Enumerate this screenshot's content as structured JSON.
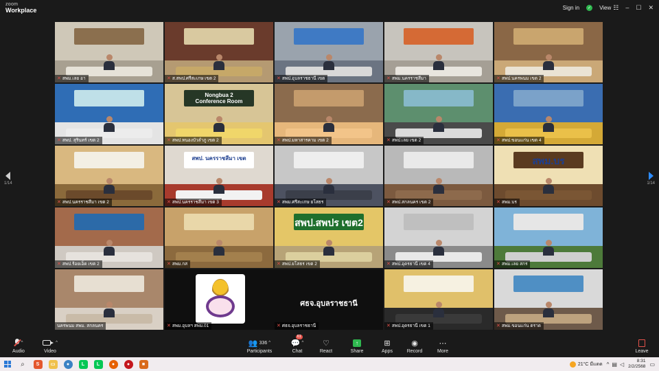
{
  "app": {
    "brand_top": "zoom",
    "brand_bottom": "Workplace",
    "sign_in": "Sign in",
    "view": "View",
    "window_controls": [
      "–",
      "☐",
      "✕"
    ]
  },
  "pager": {
    "left": "1/14",
    "right": "1/14"
  },
  "tiles": [
    {
      "caption": "สพม.เลย อา",
      "muted": true,
      "bg": "#cfc8b8",
      "floor": "#a8a091",
      "banner": "#8b6f4e",
      "table": "#e6e2d8",
      "active": true
    },
    {
      "caption": "ส.สพป.ศรีสะเกษ เขต 2",
      "muted": true,
      "bg": "#6a3b2c",
      "floor": "#b59a72",
      "banner": "#d9c9a0",
      "table": "#c6a868",
      "big": ""
    },
    {
      "caption": "สพป.อุบลราชธานี เขต",
      "muted": true,
      "bg": "#9aa3ad",
      "floor": "#6b7482",
      "banner": "#3f7ac4",
      "table": "#d8d8d8"
    },
    {
      "caption": "สพม.นครราชสีมา",
      "muted": true,
      "bg": "#c7c4bd",
      "floor": "#a59f95",
      "banner": "#d56a35",
      "table": "#e8e5de"
    },
    {
      "caption": "สพป.นครพนม เขต 2",
      "muted": true,
      "bg": "#8a6746",
      "floor": "#caa877",
      "banner": "#c9a56e",
      "table": "#eae3d4"
    },
    {
      "caption": "สพป. สุรินทร์ เขต 2",
      "muted": true,
      "bg": "#2f6db5",
      "floor": "#e4e4e4",
      "banner": "#bfe0e8",
      "table": "#ececec"
    },
    {
      "caption": "สพป.หนองบัวลำภู เขต 2",
      "muted": true,
      "bg": "#d7c596",
      "floor": "#e4c66f",
      "banner": "#263726",
      "table": "#f0d66a",
      "big": "Nongbua 2\nConference Room"
    },
    {
      "caption": "สพป.มหาสารคาม เขต 2",
      "muted": true,
      "bg": "#8b6b4d",
      "floor": "#e6b77b",
      "banner": "#c49b6c",
      "table": "#f2c489"
    },
    {
      "caption": "สพป.เลย เขต 2",
      "muted": true,
      "bg": "#5d8f6e",
      "floor": "#4a4a4a",
      "banner": "#86b8c8",
      "table": "#dadada"
    },
    {
      "caption": "สพป.ขอนแก่น เขต 4",
      "muted": true,
      "bg": "#3a6db1",
      "floor": "#d4a936",
      "banner": "#7ba2c9",
      "table": "#eac049"
    },
    {
      "caption": "สพป.นครราชสีมา เขต 2",
      "muted": true,
      "bg": "#d9b880",
      "floor": "#8b6a3b",
      "banner": "#f3efe4",
      "table": "#6b4a2b"
    },
    {
      "caption": "สพป.นครราชสีมา เขต 3",
      "muted": true,
      "bg": "#dfd9d0",
      "floor": "#a83b2d",
      "banner": "#ffffff",
      "table": "#f2f2f2",
      "big": "สพป. นครราชสีมา เขต"
    },
    {
      "caption": "สพม.ศรีสะเกษ ยโสธร",
      "muted": true,
      "bg": "#c7c7c7",
      "floor": "#4d5261",
      "banner": "#eeeeee",
      "table": "#3b3f4a"
    },
    {
      "caption": "สพป.สกลนคร เขต 2",
      "muted": true,
      "bg": "#b9b9b9",
      "floor": "#7c5a3f",
      "banner": "#e9e9e9",
      "table": "#8d6a4c"
    },
    {
      "caption": "สพม.บร",
      "muted": true,
      "bg": "#efe0b4",
      "floor": "#6d4b2e",
      "banner": "#5a3b20",
      "table": "#7a5634",
      "big": "สพม.บร"
    },
    {
      "caption": "สพป.ร้อยเอ็ด เขต 2",
      "muted": true,
      "bg": "#a36a4b",
      "floor": "#cfc9c2",
      "banner": "#2c6aa8",
      "table": "#e6e2dd"
    },
    {
      "caption": "สพม.กส",
      "muted": true,
      "bg": "#c8a26a",
      "floor": "#8c6a3e",
      "banner": "#e9d7a9",
      "table": "#a3804d"
    },
    {
      "caption": "สพป.ยโสธร เขต 2",
      "muted": true,
      "bg": "#e4c667",
      "floor": "#b7a377",
      "banner": "#1f6f2d",
      "table": "#dbcf9e",
      "big": "สพป.สพปร เขต2"
    },
    {
      "caption": "สพป.อุดรธานี เขต 4",
      "muted": true,
      "bg": "#d3d3d3",
      "floor": "#8a8a8a",
      "banner": "#bfbfbf",
      "table": "#e8e8e8"
    },
    {
      "caption": "สพม.เลย สกร",
      "muted": true,
      "bg": "#7fb3d8",
      "floor": "#4d7a3a",
      "banner": "#e6e6e6",
      "table": "#cfcfcf"
    },
    {
      "caption": "นครพนม สพม. สกลนคร",
      "muted": false,
      "bg": "#a9876b",
      "floor": "#d9d0c5",
      "banner": "#e7dfd2",
      "table": "#c9bba8"
    },
    {
      "caption": "สพม.อุบลฯ สพม.01",
      "muted": true,
      "logo": true,
      "name": "ศธจ.อุบลราชธานี"
    },
    {
      "caption": "ศธจ.อุบลราชธานี",
      "muted": true,
      "hidden": true
    },
    {
      "caption": "สพป.อุดรธานี เขต 1",
      "muted": true,
      "bg": "#e0c06a",
      "floor": "#2a2a2a",
      "banner": "#f6f1e1",
      "table": "#3a3a3a"
    },
    {
      "caption": "สพม.ขอนแก่น ตราด",
      "muted": true,
      "bg": "#d9d9d9",
      "floor": "#6e5a4a",
      "banner": "#4f8fc4",
      "table": "#bda27e"
    }
  ],
  "toolbar": {
    "audio": "Audio",
    "video": "Video",
    "participants": "Participants",
    "participants_count": "336",
    "chat": "Chat",
    "chat_badge": "61",
    "react": "React",
    "share": "Share",
    "apps": "Apps",
    "record": "Record",
    "more": "More",
    "leave": "Leave"
  },
  "taskbar": {
    "weather": "21°C มีแดด",
    "time": "8:31",
    "date": "2/2/2568"
  }
}
